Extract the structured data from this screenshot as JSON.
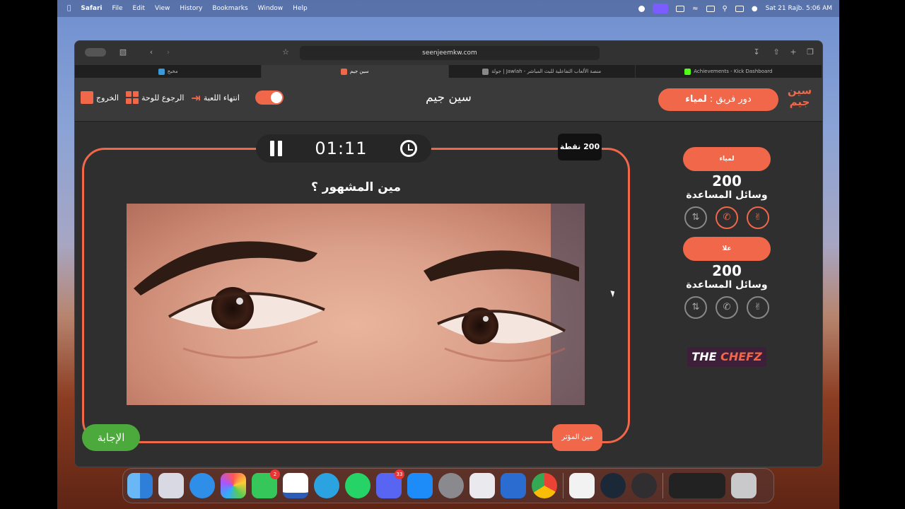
{
  "menubar": {
    "app_name": "Safari",
    "items": [
      "File",
      "Edit",
      "View",
      "History",
      "Bookmarks",
      "Window",
      "Help"
    ],
    "clock": "Sat 21 Rajb. 5:06 AM"
  },
  "browser": {
    "url": "seenjeemkw.com",
    "tabs": [
      {
        "title": "مخبخ",
        "active": false
      },
      {
        "title": "سين جيم",
        "active": true
      },
      {
        "title": "جولة | Jawlah - منصة الألعاب التفاعلية للبث المباشر",
        "active": false
      },
      {
        "title": "Achievements - Kick Dashboard",
        "active": false
      }
    ]
  },
  "header": {
    "logo_text": "سين جيم",
    "turn_label": "دور فريق :",
    "turn_team": "لمياء",
    "site_title": "سين جيم",
    "exit_label": "الخروج",
    "back_label": "الرجوع للوحة",
    "end_label": "انتهاء اللعبة"
  },
  "game": {
    "timer": "01:11",
    "points": "200 نقطة",
    "question": "مين المشهور ؟",
    "answer_button": "الإجابة",
    "influencer_button": "مين المؤثر"
  },
  "teams": [
    {
      "name": "لمياء",
      "score": "200",
      "aids_label": "وسائل المساعدة"
    },
    {
      "name": "علا",
      "score": "200",
      "aids_label": "وسائل المساعدة"
    }
  ],
  "sponsor": {
    "part1": "THE ",
    "part2": "CHEFZ"
  },
  "dock": {
    "messages_badge": "2",
    "discord_badge": "33"
  },
  "colors": {
    "accent": "#f0674a",
    "answer_green": "#4caa3c",
    "panel_bg": "#2f2f2f"
  },
  "icons": [
    "apple-icon",
    "pause-icon",
    "restart-icon",
    "exit-icon",
    "grid-icon",
    "end-arrow-icon",
    "hand-icon",
    "phone-icon",
    "swap-icon"
  ]
}
